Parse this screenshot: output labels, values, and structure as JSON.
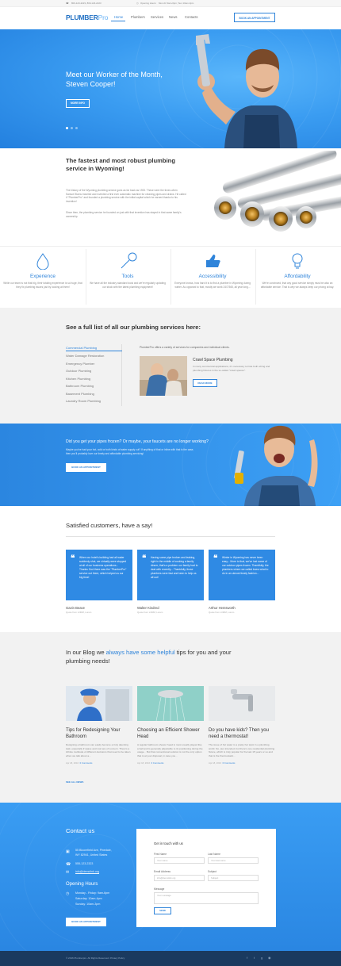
{
  "topbar": {
    "phone": "800-123-2223, 800-123-2223",
    "hours_label": "Opening Hours:",
    "hours": "Mon-Fri 9am-6pm; Sun 10am-3pm"
  },
  "header": {
    "logo_main": "PLUMBER",
    "logo_accent": "Pro",
    "nav": [
      "Home",
      "Plumbers",
      "Services",
      "News",
      "Contacts"
    ],
    "cta": "BOOK AN APPOINTMENT"
  },
  "hero": {
    "title_line1": "Meet our Worker of the Month,",
    "title_line2": "Steven Cooper!",
    "button": "MORE INFO"
  },
  "about": {
    "title_line1": "The fastest and most robust plumbing",
    "title_line2": "service in Wyoming!",
    "p1": "The history of the Wyoming plumbing service goes as far back as 1933. These were the times when Samuel Burns traveled and invented a first ever automatic machine for cleaning pipes and drains. He called it \"PlumberPro\" and founded a plumbing service with the initial capital which he earned thanks to his invention!",
    "p2": "Since then, the plumbing service he founded on just with that invention has stayed in that same family's ownership."
  },
  "features": [
    {
      "icon": "water-drop-icon",
      "title": "Experience",
      "text": "While our team is not that big, their totaling experience is so huge, that they fix plumbing issues just by looking at them!"
    },
    {
      "icon": "wrench-icon",
      "title": "Tools",
      "text": "We have all the industry standard tools and we're regularly updating our stock with the latest plumbing equipment!"
    },
    {
      "icon": "thumbs-up-icon",
      "title": "Accessibility",
      "text": "Everyone knows, how hard it is to find a plumber in Wyoming during winter. As opposed to that, mostly we work 24/7/365, all year long..."
    },
    {
      "icon": "lightbulb-icon",
      "title": "Affordability",
      "text": "We're convinced, that any good service simply must be also an affordable service. That is why we always keep our pricing at bay."
    }
  ],
  "services": {
    "title": "See a full list of all our plumbing services here:",
    "items": [
      "Commercial Plumbing",
      "Water Damage Restoration",
      "Emergency Plumber",
      "Outdoor Plumbing",
      "Kitchen Plumbing",
      "Bathroom Plumbing",
      "Basement Plumbing",
      "Laundry Room Plumbing"
    ],
    "intro": "PlumberPro offers a variety of services for companies and individual clients.",
    "card_title": "Crawl Space Plumbing",
    "card_text": "In many commercial applications, it's necessary to hide both wiring and plumbing fixtures in the so-called \"crawl spaces\".",
    "card_button": "READ MORE"
  },
  "frozen": {
    "title": "Did you get your pipes frozen? Or maybe, your faucets are no longer working?",
    "text": "Maybe you've had your hot, cold or both kinds of water supply cut? If anything of that or inline with that is the case, then you'll probably love our timely and affordable plumbing servicing!",
    "button": "BOOK AN APPOINTMENT"
  },
  "testimonials": {
    "title": "Satisfied customers, have a say!",
    "items": [
      {
        "quote": "When our hotel's building had all water suddenly shut, we virtually were stopped at all of our business operations... Thanks God there was the \"PlumberPro\" service out there, which helped us our big time!",
        "name": "Gavin Beave",
        "role": "Quote from LORM, Lorem"
      },
      {
        "quote": "Having some pipe broken and leaking, right in the middle of cooking a family dinner, that's a problem our family had to deal with recently... Thankfully, those plumbers were fast and keen to help us all out!",
        "name": "Walter Kindred",
        "role": "Quote from LORM, Lorem"
      },
      {
        "quote": "Winter in Wyoming has never been easy... More to that, we've lost some of our outdoor pipes frozen. Thankfully, the plumbers where we called knew what to do in an utmost timely fashion...",
        "name": "Arthur Hemsworth",
        "role": "Quote from LORM, Lorem"
      }
    ]
  },
  "blog": {
    "title_pre": "In our Blog we ",
    "title_accent": "always have some helpful",
    "title_post": " tips for you and your",
    "title_line2": "plumbing needs!",
    "posts": [
      {
        "title": "Tips for Redesigning Your Bathroom",
        "text": "Designing a bathroom can easily become a truly daunting task, especially if space and cost are of concern. There's a infinite multitude of different decisions that need to be taken when we talk about a...",
        "date": "Apr 18, 2016",
        "comments": "0 Comments"
      },
      {
        "title": "Choosing an Efficient Shower Head",
        "text": "A regular bathroom shower head is most usually played like a ball and is generally adjustable to its positioning during the usage... But that conventional solution is not the only option that is at your disposal, in case you...",
        "date": "Apr 18, 2016",
        "comments": "0 Comments"
      },
      {
        "title": "Do you have kids? Then you need a thermostat!",
        "text": "The issue of hot water is a pretty hot topic in a plumbing world. No, pun intended, but there's one residential plumbing fixture, which is truly popular for the last 15 years or so and that is the thermostatic...",
        "date": "Apr 18, 2016",
        "comments": "0 Comments"
      }
    ],
    "see_all": "SEE ALL NEWS"
  },
  "contact": {
    "title": "Contact us",
    "address_line1": "55 Bloomfield Ave, Pinedale,",
    "address_line2": "WY 82941, United States",
    "phone": "555-123-2323",
    "email": "info@demolink.org",
    "hours_title": "Opening Hours",
    "hours_line1": "Monday - Friday: 9am-6pm",
    "hours_line2": "Saturday: 10am-4pm",
    "hours_line3": "Sunday: 10am-3pm",
    "button": "BOOK AN APPOINTMENT",
    "form": {
      "title": "Get in touch with us",
      "first_label": "First Name",
      "first_ph": "Your name",
      "last_label": "Last Name",
      "last_ph": "Your last name",
      "email_label": "Email Address",
      "email_ph": "info@demolink.org",
      "subject_label": "Subject",
      "subject_ph": "Subject",
      "message_label": "Message",
      "message_ph": "Your message",
      "send": "SEND"
    }
  },
  "footer": {
    "copyright": "© 2016 Plumberpro. All Rights Reserved. Privacy Policy"
  },
  "colors": {
    "accent": "#2f84da",
    "hero_blue": "#3a9cf1",
    "footer": "#1a3a5f"
  }
}
